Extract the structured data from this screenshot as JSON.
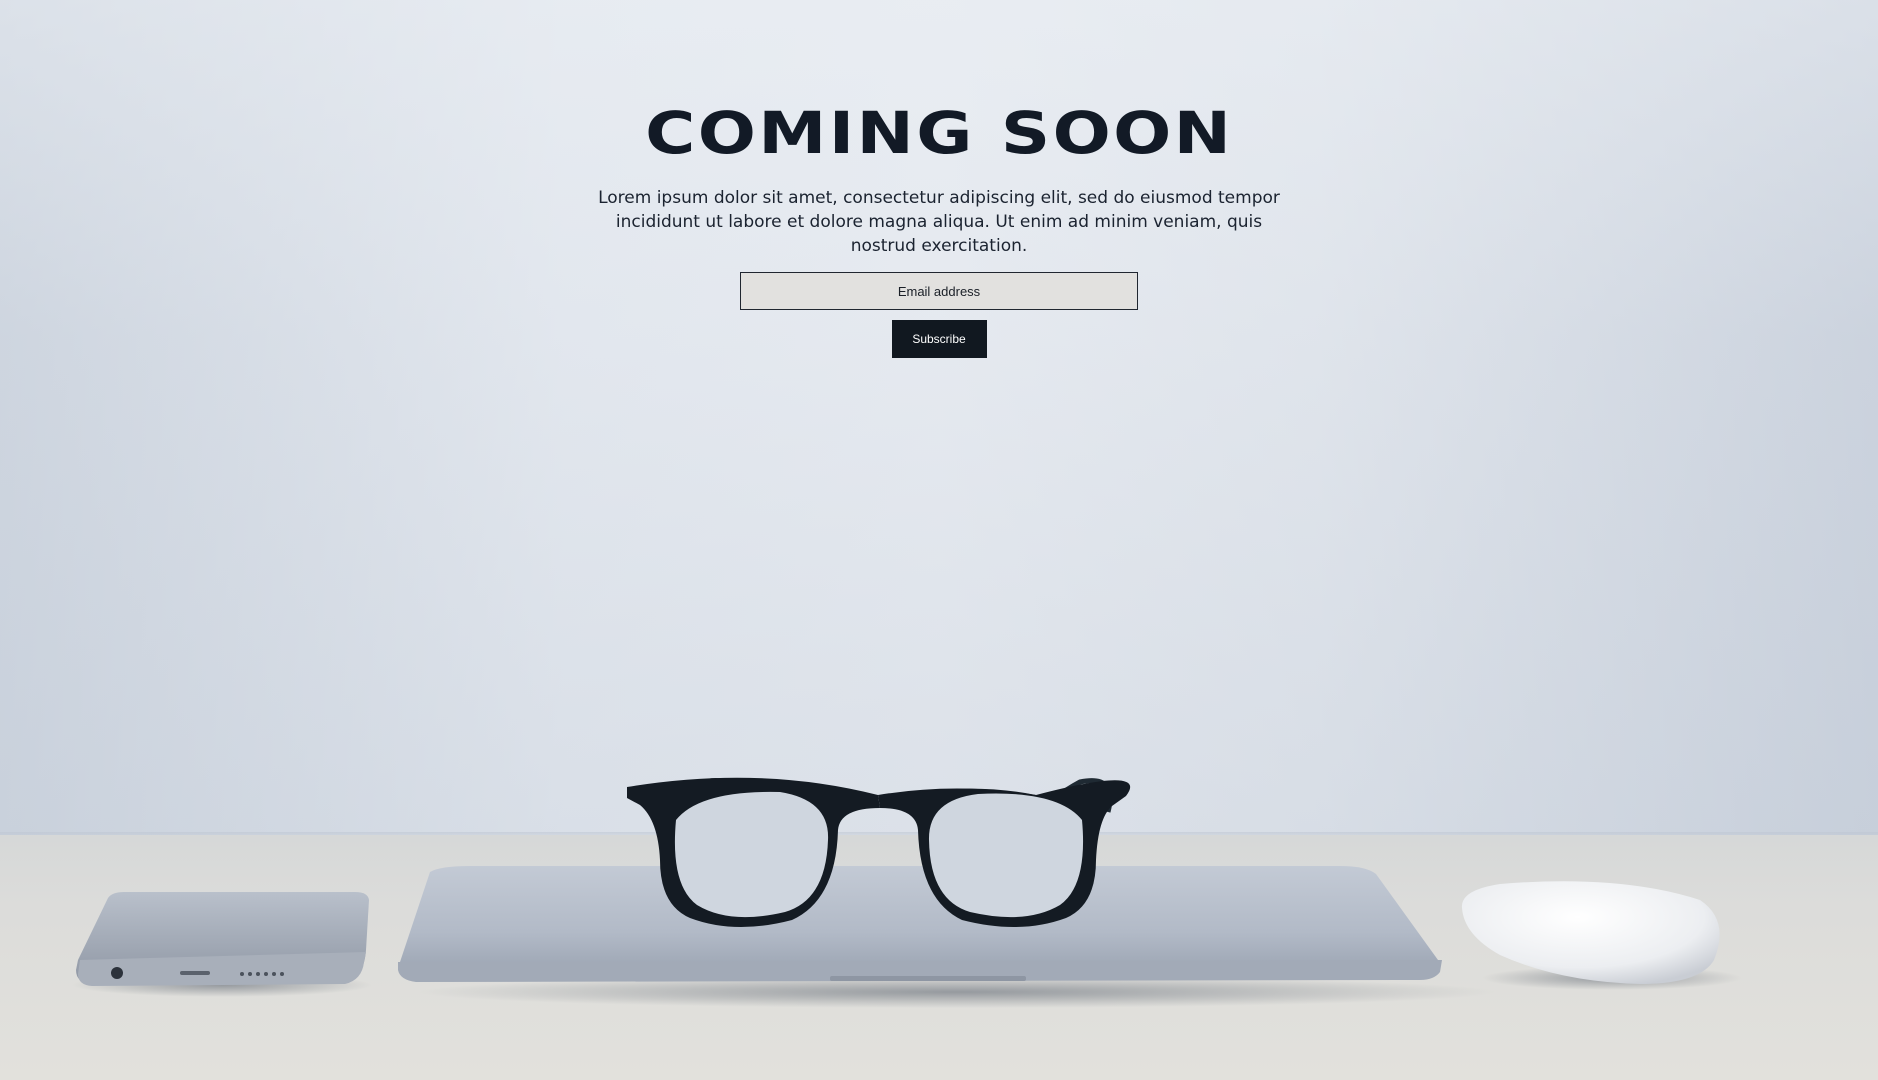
{
  "hero": {
    "title": "COMING SOON",
    "description": "Lorem ipsum dolor sit amet, consectetur adipiscing elit, sed do eiusmod tempor incididunt ut labore et dolore magna aliqua. Ut enim ad minim veniam, quis nostrud exercitation."
  },
  "signup": {
    "email_placeholder": "Email address",
    "subscribe_label": "Subscribe"
  },
  "colors": {
    "text_dark": "#121a26",
    "button_bg": "#111820",
    "input_bg": "#e2e1df"
  },
  "background": {
    "objects": [
      "phone",
      "laptop",
      "glasses",
      "mouse"
    ]
  }
}
